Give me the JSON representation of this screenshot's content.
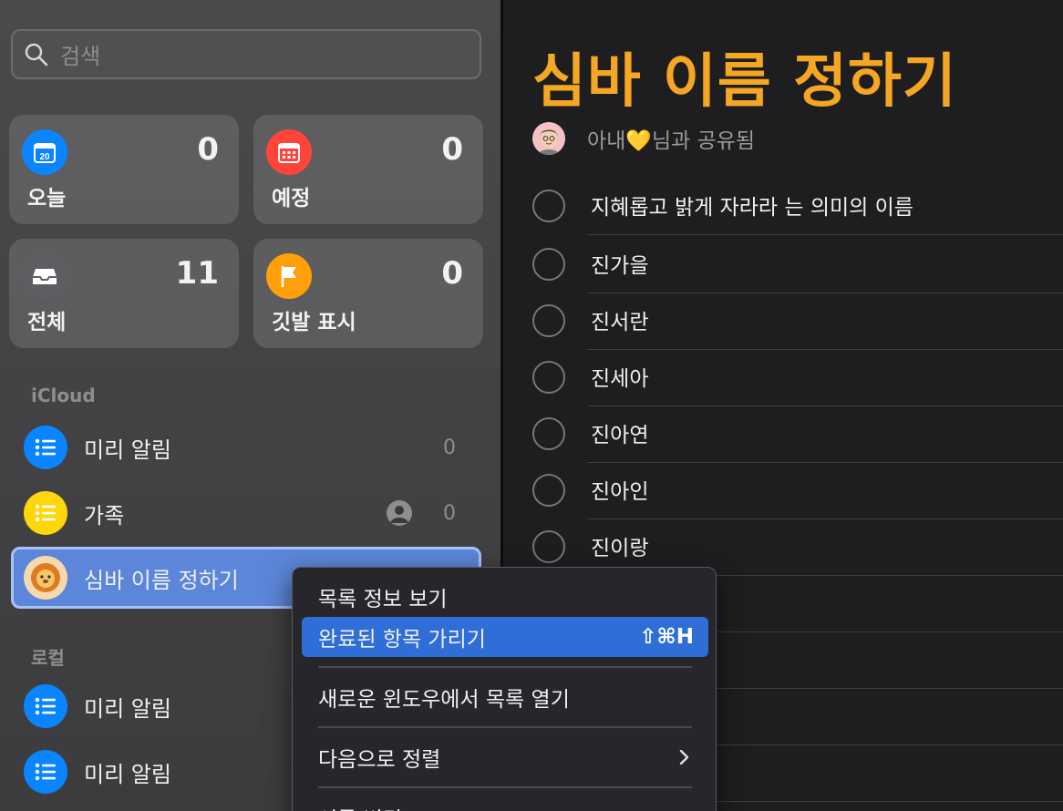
{
  "search": {
    "placeholder": "검색",
    "icon": "search-icon"
  },
  "smart_lists": [
    {
      "label": "오늘",
      "count": "0",
      "icon": "calendar-today-icon",
      "icon_text": "20",
      "color": "#0a84ff"
    },
    {
      "label": "예정",
      "count": "0",
      "icon": "calendar-grid-icon",
      "color": "#ff453a"
    },
    {
      "label": "전체",
      "count": "11",
      "icon": "tray-icon",
      "color": "#5e5e62"
    },
    {
      "label": "깃발 표시",
      "count": "0",
      "icon": "flag-icon",
      "color": "#ff9f0a"
    }
  ],
  "sections": {
    "icloud": "iCloud",
    "local": "로컬"
  },
  "icloud_lists": [
    {
      "name": "미리 알림",
      "count": "0",
      "icon": "list-bullet-icon",
      "color": "#0a84ff"
    },
    {
      "name": "가족",
      "count": "0",
      "icon": "list-bullet-icon",
      "color": "#ffd60a",
      "shared": true
    },
    {
      "name": "심바 이름 정하기",
      "count": "",
      "icon": "lion-emoji-icon",
      "color": "#f7d9b0",
      "selected": true
    }
  ],
  "local_lists": [
    {
      "name": "미리 알림",
      "icon": "list-bullet-icon",
      "color": "#0a84ff"
    },
    {
      "name": "미리 알림",
      "icon": "list-bullet-icon",
      "color": "#0a84ff"
    }
  ],
  "main": {
    "title": "심바 이름 정하기",
    "shared_text": "아내💛님과 공유됨",
    "title_color": "#f5a623",
    "reminders": [
      "지혜롭고 밝게 자라라 는 의미의 이름",
      "진가을",
      "진서란",
      "진세아",
      "진아연",
      "진아인",
      "진이랑",
      "",
      "",
      "",
      ""
    ]
  },
  "context_menu": {
    "items": [
      {
        "label": "목록 정보 보기"
      },
      {
        "label": "완료된 항목 가리기",
        "shortcut": "⇧⌘H",
        "highlight": true
      },
      {
        "label": "새로운 윈도우에서 목록 열기"
      },
      {
        "label": "다음으로 정렬",
        "submenu": true
      },
      {
        "label": "이름 변경"
      }
    ]
  }
}
